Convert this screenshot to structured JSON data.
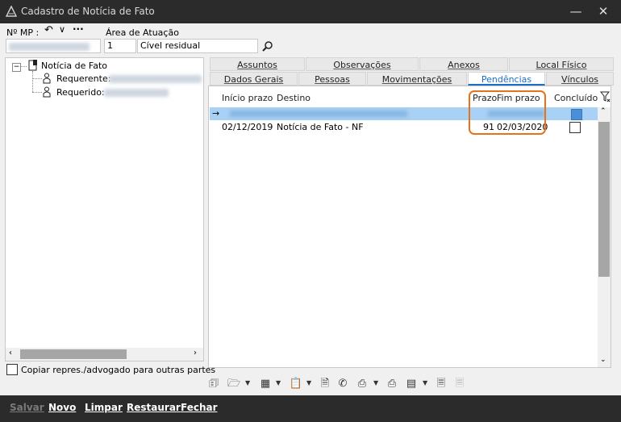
{
  "window": {
    "title": "Cadastro de Notícia de Fato",
    "minimize_icon": "minimize-icon",
    "close_icon": "close-icon"
  },
  "toolbar": {
    "mp_label": "Nº MP :",
    "area_label": "Área de Atuação",
    "area_code": "1",
    "area_name": "Cível residual"
  },
  "tree": {
    "root": "Notícia de Fato",
    "children": [
      {
        "label": "Requerente:"
      },
      {
        "label": "Requerido:"
      }
    ]
  },
  "copy_checkbox_label": "Copiar repres./advogado para outras partes",
  "tabs_row1": [
    "Assuntos",
    "Observações",
    "Anexos",
    "Local Físico"
  ],
  "tabs_row2": [
    "Dados Gerais",
    "Pessoas",
    "Movimentações",
    "Pendências",
    "Vínculos"
  ],
  "active_tab": "Pendências",
  "grid": {
    "columns": [
      "Início prazo",
      "Destino",
      "Prazo",
      "Fim prazo",
      "Concluído"
    ],
    "rows": [
      {
        "inicio": "02/12/2019",
        "destino": "Notícia de Fato - NF",
        "prazo": "91",
        "fim": "02/03/2020",
        "concluido": false
      }
    ]
  },
  "highlight_color": "#e8711a",
  "accent_color": "#1b6fc6",
  "bottom_buttons": [
    "Salvar",
    "Novo",
    "Limpar",
    "Restaurar",
    "Fechar"
  ]
}
